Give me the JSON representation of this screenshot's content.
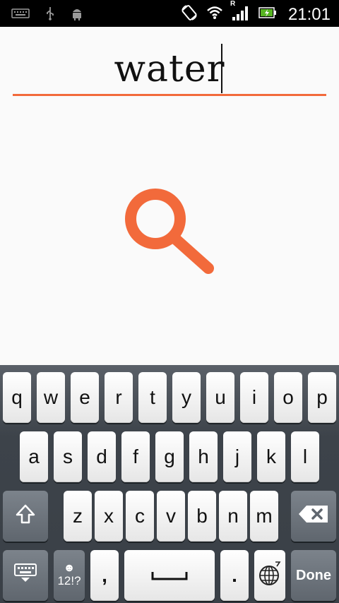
{
  "status_bar": {
    "time": "21:01",
    "icons": [
      "keyboard-icon",
      "usb-icon",
      "android-icon",
      "rotation-icon",
      "wifi-icon",
      "signal-roaming-icon",
      "battery-charging-icon"
    ],
    "roaming_letter": "R"
  },
  "search": {
    "query": "water",
    "accent_color": "#f26a3b"
  },
  "keyboard": {
    "row1": [
      "q",
      "w",
      "e",
      "r",
      "t",
      "y",
      "u",
      "i",
      "o",
      "p"
    ],
    "row2": [
      "a",
      "s",
      "d",
      "f",
      "g",
      "h",
      "j",
      "k",
      "l"
    ],
    "row3": [
      "z",
      "x",
      "c",
      "v",
      "b",
      "n",
      "m"
    ],
    "comma": ",",
    "period": ".",
    "symbols_label": "12!?",
    "done_label": "Done"
  }
}
